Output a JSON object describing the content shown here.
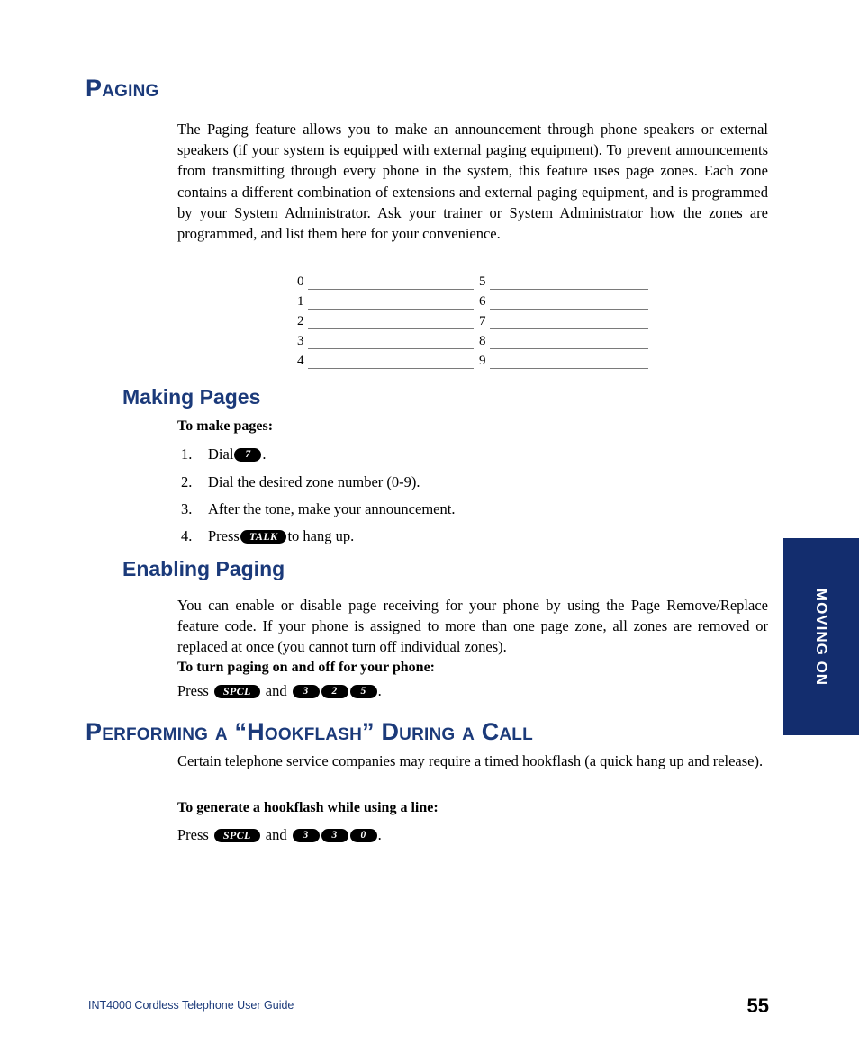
{
  "document": {
    "title": "INT4000 Cordless Telephone User Guide",
    "page_number": "55",
    "accent_color": "#1b3a7a",
    "tab_color": "#132d6e"
  },
  "side_tab": {
    "label": "MOVING ON"
  },
  "sections": {
    "paging": {
      "heading": "Paging",
      "intro": "The Paging feature allows you to make an announcement through phone speakers or external speakers (if your system is equipped with external paging equipment). To prevent announcements from transmitting through every phone in the system, this feature uses page zones. Each zone contains a different combination of extensions and external paging equipment, and is programmed by your System Administrator. Ask your trainer or System Administrator how the zones are programmed, and list them here for your convenience.",
      "zone_labels": [
        "0",
        "1",
        "2",
        "3",
        "4",
        "5",
        "6",
        "7",
        "8",
        "9"
      ]
    },
    "making_pages": {
      "heading": "Making Pages",
      "lead_in": "To make pages:",
      "steps": [
        {
          "num": "1.",
          "before": "Dial ",
          "key": "7",
          "key_type": "digit",
          "after": "."
        },
        {
          "num": "2.",
          "before": "Dial the desired zone number (0-9).",
          "key": "",
          "key_type": "",
          "after": ""
        },
        {
          "num": "3.",
          "before": "After the tone, make your announcement.",
          "key": "",
          "key_type": "",
          "after": ""
        },
        {
          "num": "4.",
          "before": "Press ",
          "key": "TALK",
          "key_type": "word",
          "after": " to hang up."
        }
      ]
    },
    "enabling_paging": {
      "heading": "Enabling Paging",
      "body": "You can enable or disable page receiving for your phone by using the Page Remove/Replace feature code. If your phone is assigned to more than one page zone, all zones are removed or replaced at once (you cannot turn off individual zones).",
      "lead_in": "To turn paging on and off for your phone:",
      "press": {
        "prefix": "Press",
        "feature_key": "SPCL",
        "conjunction": "and",
        "digits": [
          "3",
          "2",
          "5"
        ],
        "suffix": "."
      }
    },
    "hookflash": {
      "heading": "Performing a “Hookflash” During a Call",
      "body": "Certain telephone service companies may require a timed hookflash (a quick hang up and release).",
      "lead_in": "To generate a hookflash while using a line:",
      "press": {
        "prefix": "Press",
        "feature_key": "SPCL",
        "conjunction": "and",
        "digits": [
          "3",
          "3",
          "0"
        ],
        "suffix": "."
      }
    }
  }
}
